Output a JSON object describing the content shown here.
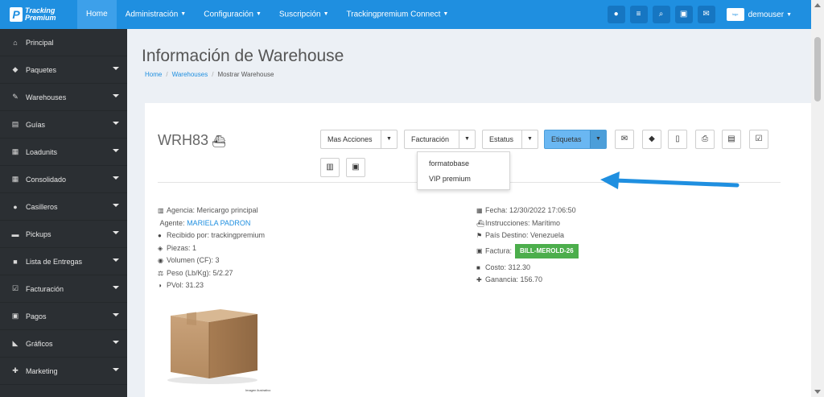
{
  "navbar": {
    "logo_text_1": "Tracking",
    "logo_text_2": "Premium",
    "items": [
      {
        "label": "Home"
      },
      {
        "label": "Administración"
      },
      {
        "label": "Configuración"
      },
      {
        "label": "Suscripción"
      },
      {
        "label": "Trackingpremium Connect"
      }
    ],
    "icons": [
      "globe-icon",
      "list-icon",
      "search-icon",
      "money-icon",
      "envelope-icon"
    ],
    "user": "demouser"
  },
  "sidebar": {
    "items": [
      {
        "label": "Principal",
        "icon": "home-icon"
      },
      {
        "label": "Paquetes",
        "icon": "tags-icon"
      },
      {
        "label": "Warehouses",
        "icon": "edit-icon"
      },
      {
        "label": "Guías",
        "icon": "list-icon"
      },
      {
        "label": "Loadunits",
        "icon": "object-group-icon"
      },
      {
        "label": "Consolidado",
        "icon": "table-icon"
      },
      {
        "label": "Casilleros",
        "icon": "map-marker-icon"
      },
      {
        "label": "Pickups",
        "icon": "car-icon"
      },
      {
        "label": "Lista de Entregas",
        "icon": "truck-icon"
      },
      {
        "label": "Facturación",
        "icon": "check-square-icon"
      },
      {
        "label": "Pagos",
        "icon": "money-icon"
      },
      {
        "label": "Gráficos",
        "icon": "area-chart-icon"
      },
      {
        "label": "Marketing",
        "icon": "user-plus-icon"
      }
    ]
  },
  "page": {
    "title": "Información de Warehouse",
    "breadcrumb": {
      "home": "Home",
      "warehouses": "Warehouses",
      "current": "Mostrar Warehouse"
    }
  },
  "warehouse": {
    "code": "WRH83",
    "buttons": {
      "mas_acciones": "Mas Acciones",
      "facturacion": "Facturación",
      "estatus": "Estatus",
      "etiquetas": "Etiquetas"
    },
    "etiquetas_menu": [
      "formatobase",
      "VIP premium"
    ],
    "left": {
      "agencia": "Agencia: Mericargo principal",
      "agente_label": "Agente:",
      "agente_name": "MARIELA PADRON",
      "recibido": "Recibido por: trackingpremium",
      "piezas": "Piezas: 1",
      "volumen": "Volumen (CF): 3",
      "peso": "Peso (Lb/Kg): 5/2.27",
      "pvol": "PVol: 31.23"
    },
    "right": {
      "fecha": "Fecha: 12/30/2022 17:06:50",
      "instrucciones": "Instrucciones: Marítimo",
      "pais": "País Destino: Venezuela",
      "factura_label": "Factura:",
      "factura_badge": "BILL-MEROLD-26",
      "costo": "Costo: 312.30",
      "ganancia": "Ganancia: 156.70"
    },
    "image_caption": "Imagen ilustrativo"
  },
  "colors": {
    "navbar": "#1f8fe0",
    "sidebar": "#2b2f33",
    "badge": "#4cae4c",
    "arrow": "#1f8fe0"
  }
}
